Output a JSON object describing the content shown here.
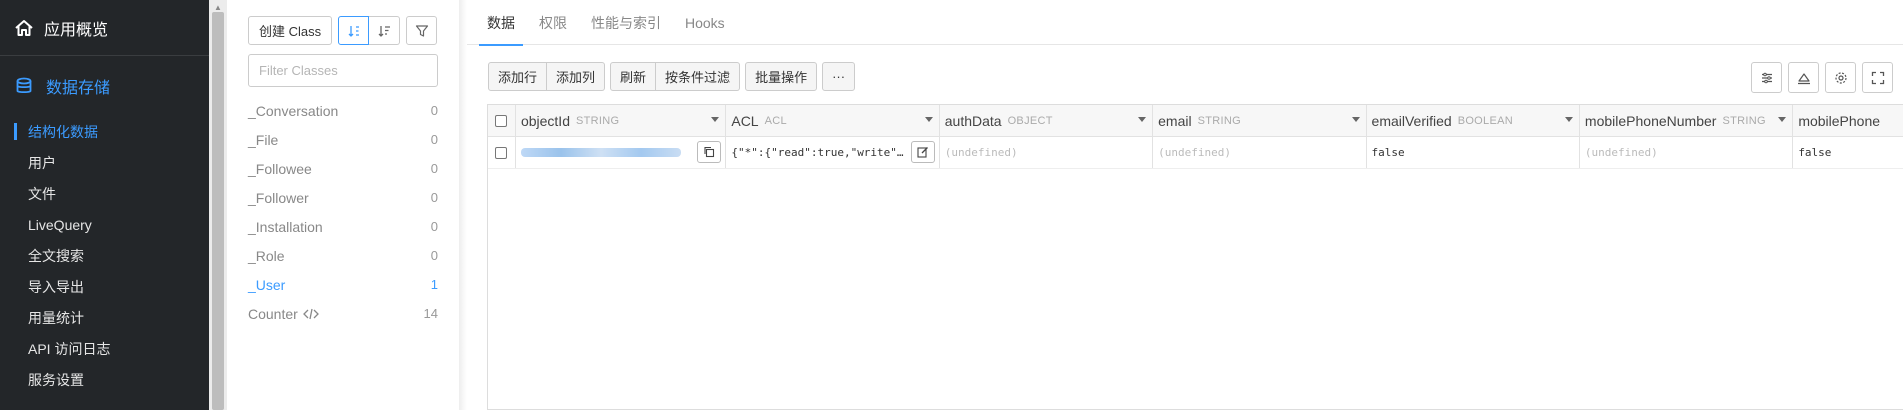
{
  "nav": {
    "top_label": "应用概览",
    "section_label": "数据存储",
    "items": [
      {
        "label": "结构化数据",
        "active": true
      },
      {
        "label": "用户"
      },
      {
        "label": "文件"
      },
      {
        "label": "LiveQuery"
      },
      {
        "label": "全文搜索"
      },
      {
        "label": "导入导出"
      },
      {
        "label": "用量统计"
      },
      {
        "label": "API 访问日志"
      },
      {
        "label": "服务设置"
      }
    ]
  },
  "class_panel": {
    "create_label": "创建 Class",
    "filter_placeholder": "Filter Classes",
    "classes": [
      {
        "name": "_Conversation",
        "count": "0"
      },
      {
        "name": "_File",
        "count": "0"
      },
      {
        "name": "_Followee",
        "count": "0"
      },
      {
        "name": "_Follower",
        "count": "0"
      },
      {
        "name": "_Installation",
        "count": "0"
      },
      {
        "name": "_Role",
        "count": "0"
      },
      {
        "name": "_User",
        "count": "1",
        "active": true
      },
      {
        "name": "Counter",
        "count": "14"
      }
    ]
  },
  "tabs": [
    {
      "label": "数据",
      "active": true
    },
    {
      "label": "权限"
    },
    {
      "label": "性能与索引"
    },
    {
      "label": "Hooks"
    }
  ],
  "toolbar": {
    "add_row": "添加行",
    "add_col": "添加列",
    "refresh": "刷新",
    "filter": "按条件过滤",
    "batch": "批量操作",
    "more": "···"
  },
  "grid": {
    "columns": [
      {
        "name": "objectId",
        "type": "STRING"
      },
      {
        "name": "ACL",
        "type": "ACL"
      },
      {
        "name": "authData",
        "type": "OBJECT"
      },
      {
        "name": "email",
        "type": "STRING"
      },
      {
        "name": "emailVerified",
        "type": "BOOLEAN"
      },
      {
        "name": "mobilePhoneNumber",
        "type": "STRING"
      },
      {
        "name": "mobilePhone",
        "type": ""
      }
    ],
    "row": {
      "acl": "{\"*\":{\"read\":true,\"write\"…",
      "authData": "(undefined)",
      "email": "(undefined)",
      "emailVerified": "false",
      "mobilePhoneNumber": "(undefined)",
      "mobilePhoneVerified": "false"
    }
  },
  "colors": {
    "accent": "#3b9bff",
    "nav_bg": "#232629"
  }
}
